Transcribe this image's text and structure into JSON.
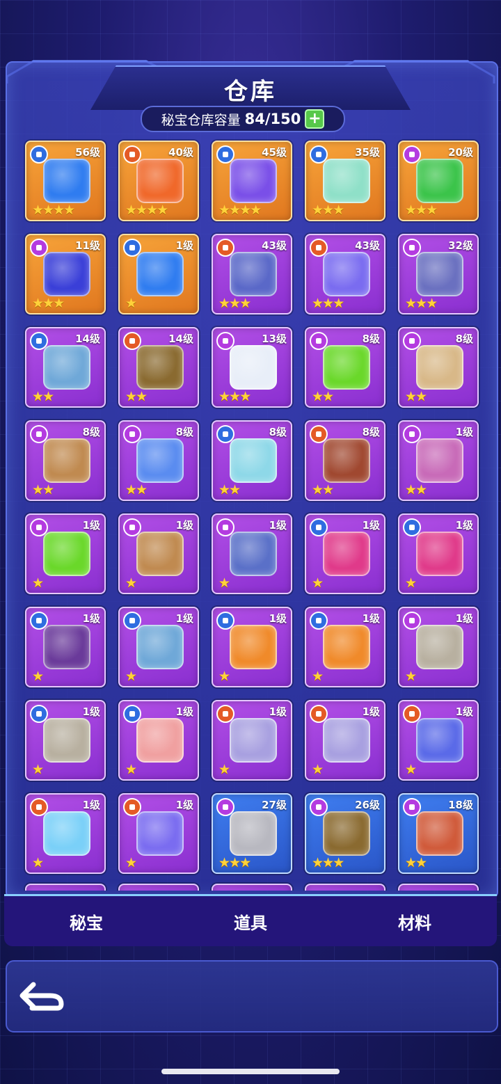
{
  "header": {
    "title": "仓库",
    "capacity_label": "秘宝仓库容量",
    "capacity_value": "84/150",
    "plus_icon": "plus-icon"
  },
  "colors": {
    "gold_card": "#f39a35",
    "purple_card": "#a243e0",
    "blue_card": "#3a72e8",
    "tab_bar": "#24157a"
  },
  "items": [
    {
      "level": "56级",
      "rarity": "gold",
      "badge": "shield",
      "stars": "★★★★",
      "art": "#2f7cf0"
    },
    {
      "level": "40级",
      "rarity": "gold",
      "badge": "crown",
      "stars": "★★★★",
      "art": "#f0682a"
    },
    {
      "level": "45级",
      "rarity": "gold",
      "badge": "shield",
      "stars": "★★★★",
      "art": "#7a4fe8"
    },
    {
      "level": "35级",
      "rarity": "gold",
      "badge": "shield",
      "stars": "★★★",
      "art": "#8fe0c8"
    },
    {
      "level": "20级",
      "rarity": "gold",
      "badge": "gem",
      "stars": "★★★",
      "art": "#3bc44a"
    },
    {
      "level": "11级",
      "rarity": "gold",
      "badge": "gem",
      "stars": "★★★",
      "art": "#3a3fd8"
    },
    {
      "level": "1级",
      "rarity": "gold",
      "badge": "shield",
      "stars": "★",
      "art": "#2f7cf0"
    },
    {
      "level": "43级",
      "rarity": "purple",
      "badge": "crown",
      "stars": "★★★",
      "art": "#5a68c8"
    },
    {
      "level": "43级",
      "rarity": "purple",
      "badge": "crown",
      "stars": "★★★",
      "art": "#7a6cf0"
    },
    {
      "level": "32级",
      "rarity": "purple",
      "badge": "gem",
      "stars": "★★★",
      "art": "#6a70c0"
    },
    {
      "level": "14级",
      "rarity": "purple",
      "badge": "shield",
      "stars": "★★",
      "art": "#6fa8d8"
    },
    {
      "level": "14级",
      "rarity": "purple",
      "badge": "crown",
      "stars": "★★",
      "art": "#8a6a30"
    },
    {
      "level": "13级",
      "rarity": "purple",
      "badge": "gem",
      "stars": "★★★",
      "art": "#e8eef8"
    },
    {
      "level": "8级",
      "rarity": "purple",
      "badge": "gem",
      "stars": "★★",
      "art": "#6ad82a"
    },
    {
      "level": "8级",
      "rarity": "purple",
      "badge": "gem",
      "stars": "★★",
      "art": "#d8b888"
    },
    {
      "level": "8级",
      "rarity": "purple",
      "badge": "gem",
      "stars": "★★",
      "art": "#c08a50"
    },
    {
      "level": "8级",
      "rarity": "purple",
      "badge": "gem",
      "stars": "★★",
      "art": "#5a8cf0"
    },
    {
      "level": "8级",
      "rarity": "purple",
      "badge": "shield",
      "stars": "★★",
      "art": "#8ed8e8"
    },
    {
      "level": "8级",
      "rarity": "purple",
      "badge": "crown",
      "stars": "★★",
      "art": "#a04830"
    },
    {
      "level": "1级",
      "rarity": "purple",
      "badge": "gem",
      "stars": "★★",
      "art": "#c86ab8"
    },
    {
      "level": "1级",
      "rarity": "purple",
      "badge": "gem",
      "stars": "★",
      "art": "#6ad82a"
    },
    {
      "level": "1级",
      "rarity": "purple",
      "badge": "gem",
      "stars": "★",
      "art": "#c08a50"
    },
    {
      "level": "1级",
      "rarity": "purple",
      "badge": "gem",
      "stars": "★",
      "art": "#5a70c8"
    },
    {
      "level": "1级",
      "rarity": "purple",
      "badge": "shield",
      "stars": "★",
      "art": "#e03a8a"
    },
    {
      "level": "1级",
      "rarity": "purple",
      "badge": "shield",
      "stars": "★",
      "art": "#e03a8a"
    },
    {
      "level": "1级",
      "rarity": "purple",
      "badge": "shield",
      "stars": "★",
      "art": "#6a3a9a"
    },
    {
      "level": "1级",
      "rarity": "purple",
      "badge": "shield",
      "stars": "★",
      "art": "#6fa8d8"
    },
    {
      "level": "1级",
      "rarity": "purple",
      "badge": "shield",
      "stars": "★",
      "art": "#f08a2a"
    },
    {
      "level": "1级",
      "rarity": "purple",
      "badge": "shield",
      "stars": "★",
      "art": "#f08a2a"
    },
    {
      "level": "1级",
      "rarity": "purple",
      "badge": "gem",
      "stars": "★",
      "art": "#b8b0a0"
    },
    {
      "level": "1级",
      "rarity": "purple",
      "badge": "shield",
      "stars": "★",
      "art": "#b8b0a0"
    },
    {
      "level": "1级",
      "rarity": "purple",
      "badge": "shield",
      "stars": "★",
      "art": "#f0a0a0"
    },
    {
      "level": "1级",
      "rarity": "purple",
      "badge": "crown",
      "stars": "★",
      "art": "#a8a0e0"
    },
    {
      "level": "1级",
      "rarity": "purple",
      "badge": "crown",
      "stars": "★",
      "art": "#a8a0e0"
    },
    {
      "level": "1级",
      "rarity": "purple",
      "badge": "crown",
      "stars": "★",
      "art": "#5a6ae8"
    },
    {
      "level": "1级",
      "rarity": "purple",
      "badge": "crown",
      "stars": "★",
      "art": "#7ad0f8"
    },
    {
      "level": "1级",
      "rarity": "purple",
      "badge": "crown",
      "stars": "★",
      "art": "#7a6cf0"
    },
    {
      "level": "27级",
      "rarity": "blue",
      "badge": "gem",
      "stars": "★★★",
      "art": "#b8b8c0"
    },
    {
      "level": "26级",
      "rarity": "blue",
      "badge": "gem",
      "stars": "★★★",
      "art": "#8a6a30"
    },
    {
      "level": "18级",
      "rarity": "blue",
      "badge": "gem",
      "stars": "★★",
      "art": "#d05a3a"
    }
  ],
  "tabs": [
    {
      "label": "秘宝"
    },
    {
      "label": "道具"
    },
    {
      "label": "材料"
    }
  ],
  "footer": {
    "back_icon": "back-arrow-icon"
  }
}
